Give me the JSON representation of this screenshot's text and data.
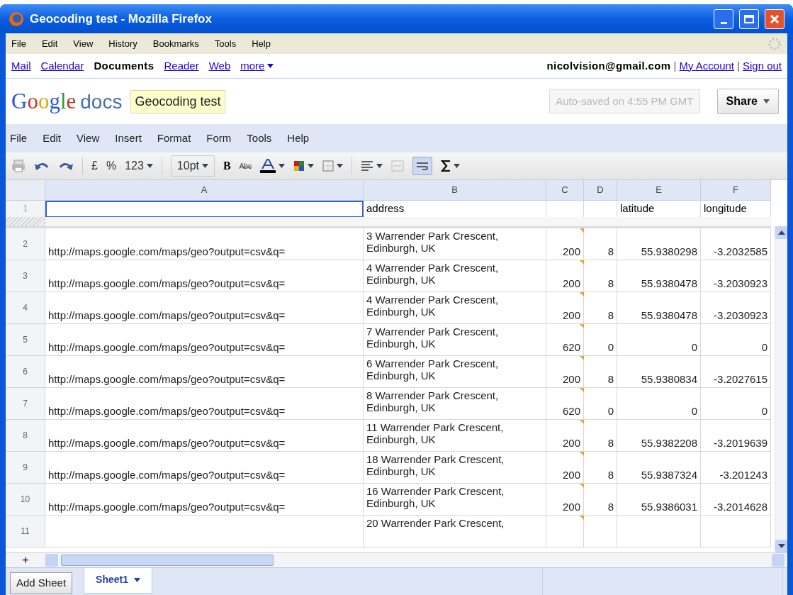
{
  "window": {
    "title": "Geocoding test - Mozilla Firefox"
  },
  "browser_menu": [
    "File",
    "Edit",
    "View",
    "History",
    "Bookmarks",
    "Tools",
    "Help"
  ],
  "google_bar": {
    "links": [
      {
        "label": "Mail",
        "selected": false
      },
      {
        "label": "Calendar",
        "selected": false
      },
      {
        "label": "Documents",
        "selected": true
      },
      {
        "label": "Reader",
        "selected": false
      },
      {
        "label": "Web",
        "selected": false
      },
      {
        "label": "more",
        "selected": false
      }
    ],
    "account_email": "nicolvision@gmail.com",
    "account_links": [
      {
        "separator": "|",
        "label": "My Account"
      },
      {
        "separator": "|",
        "label": "Sign out"
      }
    ]
  },
  "header": {
    "logo": "Google",
    "product": "docs",
    "doc_title": "Geocoding test",
    "autosave": "Auto-saved on 4:55 PM GMT",
    "share_button": "Share"
  },
  "app_menu": [
    "File",
    "Edit",
    "View",
    "Insert",
    "Format",
    "Form",
    "Tools",
    "Help"
  ],
  "toolbar": {
    "currency": "£",
    "percent": "%",
    "number_format": "123",
    "font_size": "10pt",
    "bold": "B",
    "strikethrough": "Abc",
    "wrap_text": {
      "selected": true
    }
  },
  "sheet": {
    "columns": [
      "A",
      "B",
      "C",
      "D",
      "E",
      "F"
    ],
    "header_row": {
      "number": "1",
      "cells": [
        {
          "selected": true
        },
        {
          "text": "address",
          "selected": false
        },
        {
          "selected": false
        },
        {
          "selected": false
        },
        {
          "text": "latitude",
          "selected": false
        },
        {
          "text": "longitude",
          "selected": false
        }
      ]
    },
    "rows": [
      {
        "number": "2",
        "a": "http://maps.google.com/maps/geo?output=csv&q=",
        "b": [
          "3 Warrender Park Crescent,",
          "Edinburgh, UK"
        ],
        "c": "200",
        "d": "8",
        "e": "55.9380298",
        "f": "-3.2032585",
        "note": true
      },
      {
        "number": "3",
        "a": "http://maps.google.com/maps/geo?output=csv&q=",
        "b": [
          "4 Warrender Park Crescent,",
          "Edinburgh, UK"
        ],
        "c": "200",
        "d": "8",
        "e": "55.9380478",
        "f": "-3.2030923",
        "note": true
      },
      {
        "number": "4",
        "a": "http://maps.google.com/maps/geo?output=csv&q=",
        "b": [
          "4 Warrender Park Crescent,",
          "Edinburgh, UK"
        ],
        "c": "200",
        "d": "8",
        "e": "55.9380478",
        "f": "-3.2030923",
        "note": true
      },
      {
        "number": "5",
        "a": "http://maps.google.com/maps/geo?output=csv&q=",
        "b": [
          "7 Warrender Park Crescent,",
          "Edinburgh, UK"
        ],
        "c": "620",
        "d": "0",
        "e": "0",
        "f": "0",
        "note": true
      },
      {
        "number": "6",
        "a": "http://maps.google.com/maps/geo?output=csv&q=",
        "b": [
          "6 Warrender Park Crescent,",
          "Edinburgh, UK"
        ],
        "c": "200",
        "d": "8",
        "e": "55.9380834",
        "f": "-3.2027615",
        "note": true
      },
      {
        "number": "7",
        "a": "http://maps.google.com/maps/geo?output=csv&q=",
        "b": [
          "8 Warrender Park Crescent,",
          "Edinburgh, UK"
        ],
        "c": "620",
        "d": "0",
        "e": "0",
        "f": "0",
        "note": true
      },
      {
        "number": "8",
        "a": "http://maps.google.com/maps/geo?output=csv&q=",
        "b": [
          "11 Warrender Park Crescent,",
          "Edinburgh, UK"
        ],
        "c": "200",
        "d": "8",
        "e": "55.9382208",
        "f": "-3.2019639",
        "note": true
      },
      {
        "number": "9",
        "a": "http://maps.google.com/maps/geo?output=csv&q=",
        "b": [
          "18 Warrender Park Crescent,",
          "Edinburgh, UK"
        ],
        "c": "200",
        "d": "8",
        "e": "55.9387324",
        "f": "-3.201243",
        "note": true
      },
      {
        "number": "10",
        "a": "http://maps.google.com/maps/geo?output=csv&q=",
        "b": [
          "16 Warrender Park Crescent,",
          "Edinburgh, UK"
        ],
        "c": "200",
        "d": "8",
        "e": "55.9386031",
        "f": "-3.2014628",
        "note": true
      },
      {
        "number": "11",
        "b": [
          "20 Warrender Park Crescent,"
        ],
        "note": true
      }
    ]
  },
  "footer": {
    "add_row": "+",
    "add_sheet": "Add Sheet",
    "sheet_tabs": [
      {
        "label": "Sheet1",
        "selected": true
      }
    ]
  }
}
